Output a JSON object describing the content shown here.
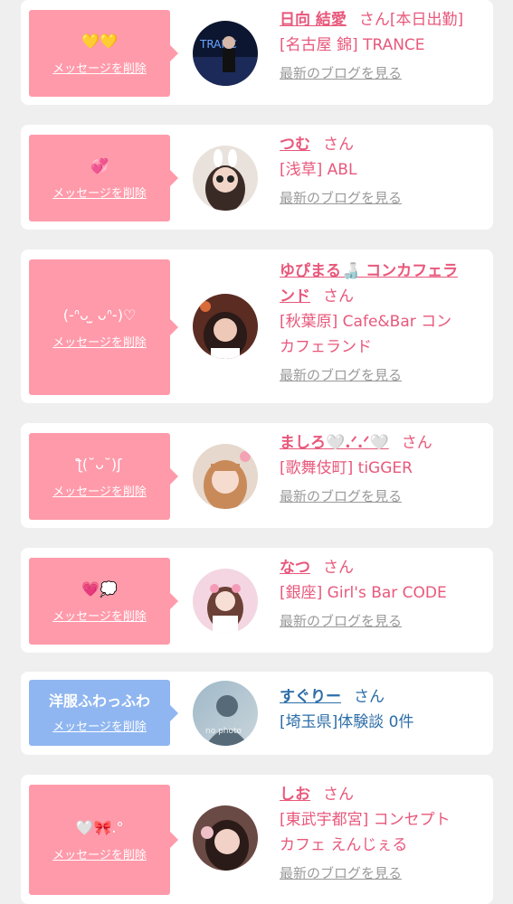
{
  "delete_label": "メッセージを削除",
  "san_label": "さん",
  "blog_label": "最新のブログを見る",
  "colors": {
    "pink_bubble": "#ff9aaa",
    "blue_bubble": "#8fb6f0",
    "pink_text": "#e8587b",
    "blue_text": "#2d6ea8",
    "muted": "#9a9a9a",
    "background": "#efefef"
  },
  "items": [
    {
      "message": "💛💛",
      "name": "日向 結愛",
      "suffix": "[本日出勤]",
      "shop": "[名古屋 錦] TRANCE",
      "blog": true
    },
    {
      "message": "💞",
      "name": "つむ",
      "suffix": "",
      "shop": "[浅草] ABL",
      "blog": true
    },
    {
      "message": "(-ᐢᴗ ̫ ᴗᐢ-)♡",
      "name": "ゆぴまる🍶 コンカフェラ\nンド",
      "suffix": "",
      "shop": "[秋葉原] Cafe&Bar コン\nカフェランド",
      "blog": true
    },
    {
      "message": "ƪ(˘ᴗ˘)ʃ",
      "name": "ましろ🤍.ᐟ.ᐟ🤍",
      "suffix": "",
      "shop": "[歌舞伎町] tiGGER",
      "blog": true
    },
    {
      "message": "💗💭",
      "name": "なつ",
      "suffix": "",
      "shop": "[銀座] Girl's Bar CODE",
      "blog": true
    },
    {
      "message": "洋服ふわっふわ",
      "name": "すぐりー",
      "suffix": "",
      "shop": "[埼玉県]体験談 0件",
      "blog": false
    },
    {
      "message": "🤍🎀.°",
      "name": "しお",
      "suffix": "",
      "shop": "[東武宇都宮] コンセプト\nカフェ えんじぇる",
      "blog": true
    }
  ]
}
